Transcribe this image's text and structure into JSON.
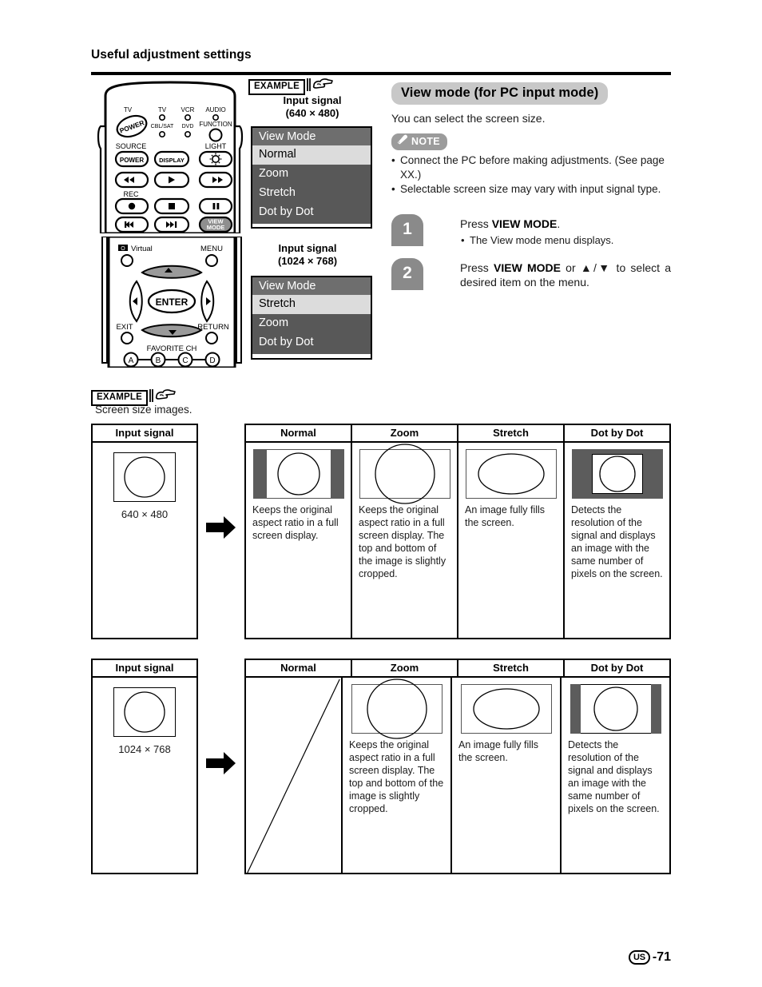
{
  "header": {
    "title": "Useful adjustment settings"
  },
  "example_badge": {
    "label": "EXAMPLE"
  },
  "osd": {
    "signal1_line1": "Input signal",
    "signal1_line2": "(640 × 480)",
    "signal2_line1": "Input signal",
    "signal2_line2": "(1024 × 768)",
    "menu1": {
      "title": "View Mode",
      "items": [
        {
          "label": "Normal",
          "selected": true
        },
        {
          "label": "Zoom",
          "selected": false
        },
        {
          "label": "Stretch",
          "selected": false
        },
        {
          "label": "Dot by Dot",
          "selected": false
        }
      ]
    },
    "menu2": {
      "title": "View Mode",
      "items": [
        {
          "label": "Stretch",
          "selected": true
        },
        {
          "label": "Zoom",
          "selected": false
        },
        {
          "label": "Dot by Dot",
          "selected": false
        }
      ]
    }
  },
  "remote_top": {
    "labels": {
      "tv_power": "TV",
      "tv": "TV",
      "cbl_sat": "CBL/SAT",
      "vcr": "VCR",
      "dvd": "DVD",
      "audio": "AUDIO",
      "function": "FUNCTION",
      "source": "SOURCE",
      "power": "POWER",
      "display": "DISPLAY",
      "light": "LIGHT",
      "rec": "REC",
      "view_mode_line1": "VIEW",
      "view_mode_line2": "MODE",
      "power_oval": "POWER"
    }
  },
  "remote_bottom": {
    "labels": {
      "virtual": "Virtual",
      "menu": "MENU",
      "enter": "ENTER",
      "exit": "EXIT",
      "return": "RETURN",
      "favorite_ch": "FAVORITE CH",
      "a": "A",
      "b": "B",
      "c": "C",
      "d": "D"
    }
  },
  "section": {
    "title": "View mode (for PC input mode)",
    "intro": "You can select the screen size.",
    "note_label": "NOTE",
    "notes": [
      "Connect the PC before making adjustments. (See page XX.)",
      "Selectable screen size may vary with input signal type."
    ],
    "steps": [
      {
        "num": "1",
        "main_prefix": "Press ",
        "main_bold": "VIEW MODE",
        "main_suffix": ".",
        "sub": "The View mode menu displays."
      },
      {
        "num": "2",
        "main_prefix": "Press ",
        "main_bold": "VIEW MODE",
        "main_suffix": " or ▲/▼ to select a desired item on the menu.",
        "sub": ""
      }
    ]
  },
  "example2": {
    "label": "EXAMPLE",
    "caption": "Screen size images."
  },
  "table_common": {
    "input_header": "Input signal",
    "headers": [
      "Normal",
      "Zoom",
      "Stretch",
      "Dot by Dot"
    ]
  },
  "table1": {
    "input_dim": "640 × 480",
    "cells": [
      {
        "mode": "Normal",
        "text": "Keeps the original aspect ratio in a full screen display.",
        "pict": "pillarbox-wide"
      },
      {
        "mode": "Zoom",
        "text": "Keeps the original aspect ratio in a full screen display. The top and bottom of the image is slightly cropped.",
        "pict": "zoom-crop"
      },
      {
        "mode": "Stretch",
        "text": "An image fully fills the screen.",
        "pict": "stretch"
      },
      {
        "mode": "Dot by Dot",
        "text": "Detects the resolution of the signal and displays an image with the same number of pixels on the screen.",
        "pict": "dot-by-dot-wide"
      }
    ]
  },
  "table2": {
    "input_dim": "1024 × 768",
    "cells": [
      {
        "mode": "Normal",
        "text": "",
        "pict": "not-available"
      },
      {
        "mode": "Zoom",
        "text": "Keeps the original aspect ratio in a full screen display. The top and bottom of the image is slightly cropped.",
        "pict": "zoom-crop"
      },
      {
        "mode": "Stretch",
        "text": "An image fully fills the screen.",
        "pict": "stretch"
      },
      {
        "mode": "Dot by Dot",
        "text": "Detects the resolution of the signal and displays an image with the same number of pixels on the screen.",
        "pict": "dot-by-dot-narrow"
      }
    ]
  },
  "footer": {
    "region": "US",
    "page": "-71"
  },
  "colors": {
    "osd_title_bg": "#6e6e6e",
    "osd_body_bg": "#585858",
    "osd_selected_bg": "#dcdcdc",
    "section_title_bg": "#c8c8c8",
    "note_badge_bg": "#9b9b9b",
    "step_num_bg": "#8a8a8a",
    "pictogram_bar": "#5c5c5c"
  }
}
